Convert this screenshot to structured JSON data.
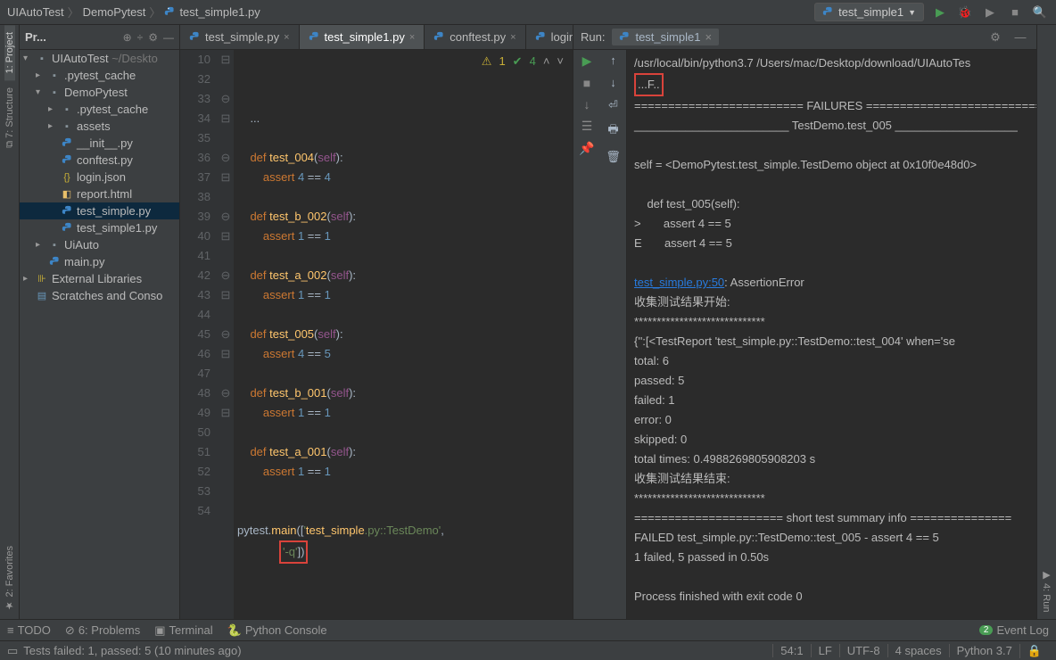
{
  "breadcrumb": {
    "a": "UIAutoTest",
    "b": "DemoPytest",
    "c": "test_simple1.py"
  },
  "runconfig": "test_simple1",
  "project": {
    "title": "Pr...",
    "root": "UIAutoTest",
    "root_path": "~/Deskto",
    "items": [
      {
        "pad": 0,
        "arrow": "▾",
        "icon": "folder",
        "name": "UIAutoTest",
        "suffix": " ~/Deskto"
      },
      {
        "pad": 1,
        "arrow": "▸",
        "icon": "folder",
        "name": ".pytest_cache"
      },
      {
        "pad": 1,
        "arrow": "▾",
        "icon": "folder",
        "name": "DemoPytest"
      },
      {
        "pad": 2,
        "arrow": "▸",
        "icon": "folder",
        "name": ".pytest_cache"
      },
      {
        "pad": 2,
        "arrow": "▸",
        "icon": "folder",
        "name": "assets"
      },
      {
        "pad": 2,
        "arrow": "",
        "icon": "py",
        "name": "__init__.py"
      },
      {
        "pad": 2,
        "arrow": "",
        "icon": "py",
        "name": "conftest.py"
      },
      {
        "pad": 2,
        "arrow": "",
        "icon": "json",
        "name": "login.json"
      },
      {
        "pad": 2,
        "arrow": "",
        "icon": "html",
        "name": "report.html"
      },
      {
        "pad": 2,
        "arrow": "",
        "icon": "py",
        "name": "test_simple.py",
        "selected": true
      },
      {
        "pad": 2,
        "arrow": "",
        "icon": "py",
        "name": "test_simple1.py"
      },
      {
        "pad": 1,
        "arrow": "▸",
        "icon": "folder",
        "name": "UiAuto"
      },
      {
        "pad": 1,
        "arrow": "",
        "icon": "py",
        "name": "main.py"
      },
      {
        "pad": 0,
        "arrow": "▸",
        "icon": "lib",
        "name": "External Libraries"
      },
      {
        "pad": 0,
        "arrow": "",
        "icon": "scratch",
        "name": "Scratches and Conso"
      }
    ]
  },
  "tabs": [
    {
      "label": "test_simple.py",
      "active": false
    },
    {
      "label": "test_simple1.py",
      "active": true
    },
    {
      "label": "conftest.py",
      "active": false
    },
    {
      "label": "login.json",
      "active": false
    }
  ],
  "inspections": {
    "warn": "1",
    "ok": "4"
  },
  "gutter_start": 10,
  "code_lines": [
    "    ...",
    "",
    "    def test_004(self):",
    "        assert 4 == 4",
    "",
    "    def test_b_002(self):",
    "        assert 1 == 1",
    "",
    "    def test_a_002(self):",
    "        assert 1 == 1",
    "",
    "    def test_005(self):",
    "        assert 4 == 5",
    "",
    "    def test_b_001(self):",
    "        assert 1 == 1",
    "",
    "    def test_a_001(self):",
    "        assert 1 == 1",
    "",
    "",
    "pytest.main(['test_simple.py::TestDemo',",
    "             '-q'])",
    ""
  ],
  "run": {
    "title": "Run:",
    "tab": "test_simple1",
    "lines": [
      "/usr/local/bin/python3.7 /Users/mac/Desktop/download/UIAutoTes",
      "...F..",
      "========================= FAILURES ===========================",
      "________________________ TestDemo.test_005 ___________________",
      "",
      "self = <DemoPytest.test_simple.TestDemo object at 0x10f0e48d0>",
      "",
      "    def test_005(self):",
      ">       assert 4 == 5",
      "E       assert 4 == 5",
      "",
      "test_simple.py:50: AssertionError",
      "收集测试结果开始:",
      "*****************************",
      "{'':[<TestReport 'test_simple.py::TestDemo::test_004' when='se",
      "total: 6",
      "passed: 5",
      "failed: 1",
      "error: 0",
      "skipped: 0",
      "total times: 0.4988269805908203 s",
      "收集测试结果结束:",
      "*****************************",
      "====================== short test summary info ===============",
      "FAILED test_simple.py::TestDemo::test_005 - assert 4 == 5",
      "1 failed, 5 passed in 0.50s",
      "",
      "Process finished with exit code 0"
    ]
  },
  "bottom": {
    "todo": "TODO",
    "problems": "6: Problems",
    "terminal": "Terminal",
    "pyconsole": "Python Console",
    "eventlog": "Event Log"
  },
  "status": {
    "msg": "Tests failed: 1, passed: 5 (10 minutes ago)",
    "pos": "54:1",
    "lf": "LF",
    "enc": "UTF-8",
    "indent": "4 spaces",
    "python": "Python 3.7"
  }
}
